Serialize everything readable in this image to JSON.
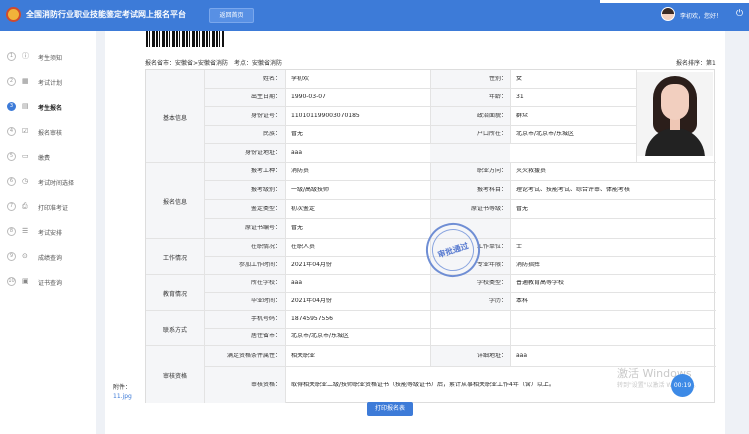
{
  "header": {
    "title": "全国消防行业职业技能鉴定考试网上报名平台",
    "home_button": "返回首页",
    "greeting": "李初欢，您好！",
    "logo_icon": "badge-logo-icon",
    "power_icon": "power-icon",
    "accent_color": "#3d7bd8"
  },
  "sidebar": {
    "items": [
      {
        "num": "1",
        "label": "考生须知",
        "icon": "info-icon"
      },
      {
        "num": "2",
        "label": "考试计划",
        "icon": "calendar-icon"
      },
      {
        "num": "3",
        "label": "考生报名",
        "icon": "form-icon"
      },
      {
        "num": "4",
        "label": "报名审核",
        "icon": "audit-icon"
      },
      {
        "num": "5",
        "label": "缴费",
        "icon": "payment-icon"
      },
      {
        "num": "6",
        "label": "考试时间选择",
        "icon": "clock-icon"
      },
      {
        "num": "7",
        "label": "打印准考证",
        "icon": "print-icon"
      },
      {
        "num": "8",
        "label": "考试安排",
        "icon": "schedule-icon"
      },
      {
        "num": "9",
        "label": "成绩查询",
        "icon": "score-icon"
      },
      {
        "num": "10",
        "label": "证书查询",
        "icon": "certificate-icon"
      }
    ],
    "active_index": 2
  },
  "form": {
    "breadcrumb": "报名省市：安徽省>安徽省消防　考点：安徽省消防",
    "order_label": "报名排序：第1",
    "sections": {
      "basic": "基本信息",
      "apply": "报名信息",
      "work": "工作情况",
      "edu": "教育情况",
      "contact": "联系方式",
      "qual": "审核资格"
    },
    "basic": {
      "name_label": "姓名：",
      "name": "李初欢",
      "gender_label": "性别：",
      "gender": "女",
      "birth_label": "出生日期：",
      "birth": "1990-03-07",
      "age_label": "年龄：",
      "age": "31",
      "id_label": "身份证号：",
      "id": "110101199003070185",
      "politics_label": "政治面貌：",
      "politics": "群众",
      "nation_label": "民族：",
      "nation": "暂无",
      "hukou_label": "户口所在：",
      "hukou": "北京市/北京市/东城区",
      "id_addr_label": "身份证地址：",
      "id_addr": "aaa"
    },
    "apply": {
      "job_label": "报考工种：",
      "job": "消防员",
      "direction_label": "职业方向：",
      "direction": "灭火救援员",
      "level_label": "报考级别：",
      "level": "一级/高级技师",
      "subject_label": "报考科目：",
      "subject": "理论考试、技能考试、综合评审、体能考核",
      "type_label": "鉴定类型：",
      "type": "初次鉴定",
      "cert_level_label": "原证书等级：",
      "cert_level": "暂无",
      "cert_no_label": "原证书编号：",
      "cert_no": "暂无"
    },
    "work": {
      "status_label": "在职情况：",
      "status": "在职人员",
      "unit_label": "工作单位：",
      "unit": "士",
      "start_label": "参加工作时间：",
      "start": "2021年04月份",
      "major_job_label": "专业年限：",
      "major_job": "消防指挥"
    },
    "edu": {
      "school_label": "所在学校：",
      "school": "aaa",
      "school_type_label": "学校类型：",
      "school_type": "普通教育高等学校",
      "grad_label": "毕业时间：",
      "grad": "2021年04月份",
      "degree_label": "学历：",
      "degree": "本科"
    },
    "contact": {
      "phone_label": "手机号码：",
      "phone": "18745957556",
      "city_label": "居住省市：",
      "city": "北京市/北京市/东城区",
      "addr_label": "详细地址：",
      "addr": "aaa"
    },
    "qual": {
      "related_label": "满足资格条件属性：",
      "related": "相关职业",
      "condition_label": "审核资格：",
      "condition": "取得相关职业二级/技师职业资格证书（技能等级证书）后，累计从事相关职业工作4年（含）以上。"
    },
    "stamp_text": "审批通过",
    "stamp_color": "#5a7cd0"
  },
  "attachment": {
    "label": "附件：",
    "file": "11.jpg"
  },
  "print_button": "打印报名表",
  "watermark": {
    "title": "激活 Windows",
    "subtitle": "转到\"设置\"以激活 Windows。"
  },
  "timer": "00:19"
}
